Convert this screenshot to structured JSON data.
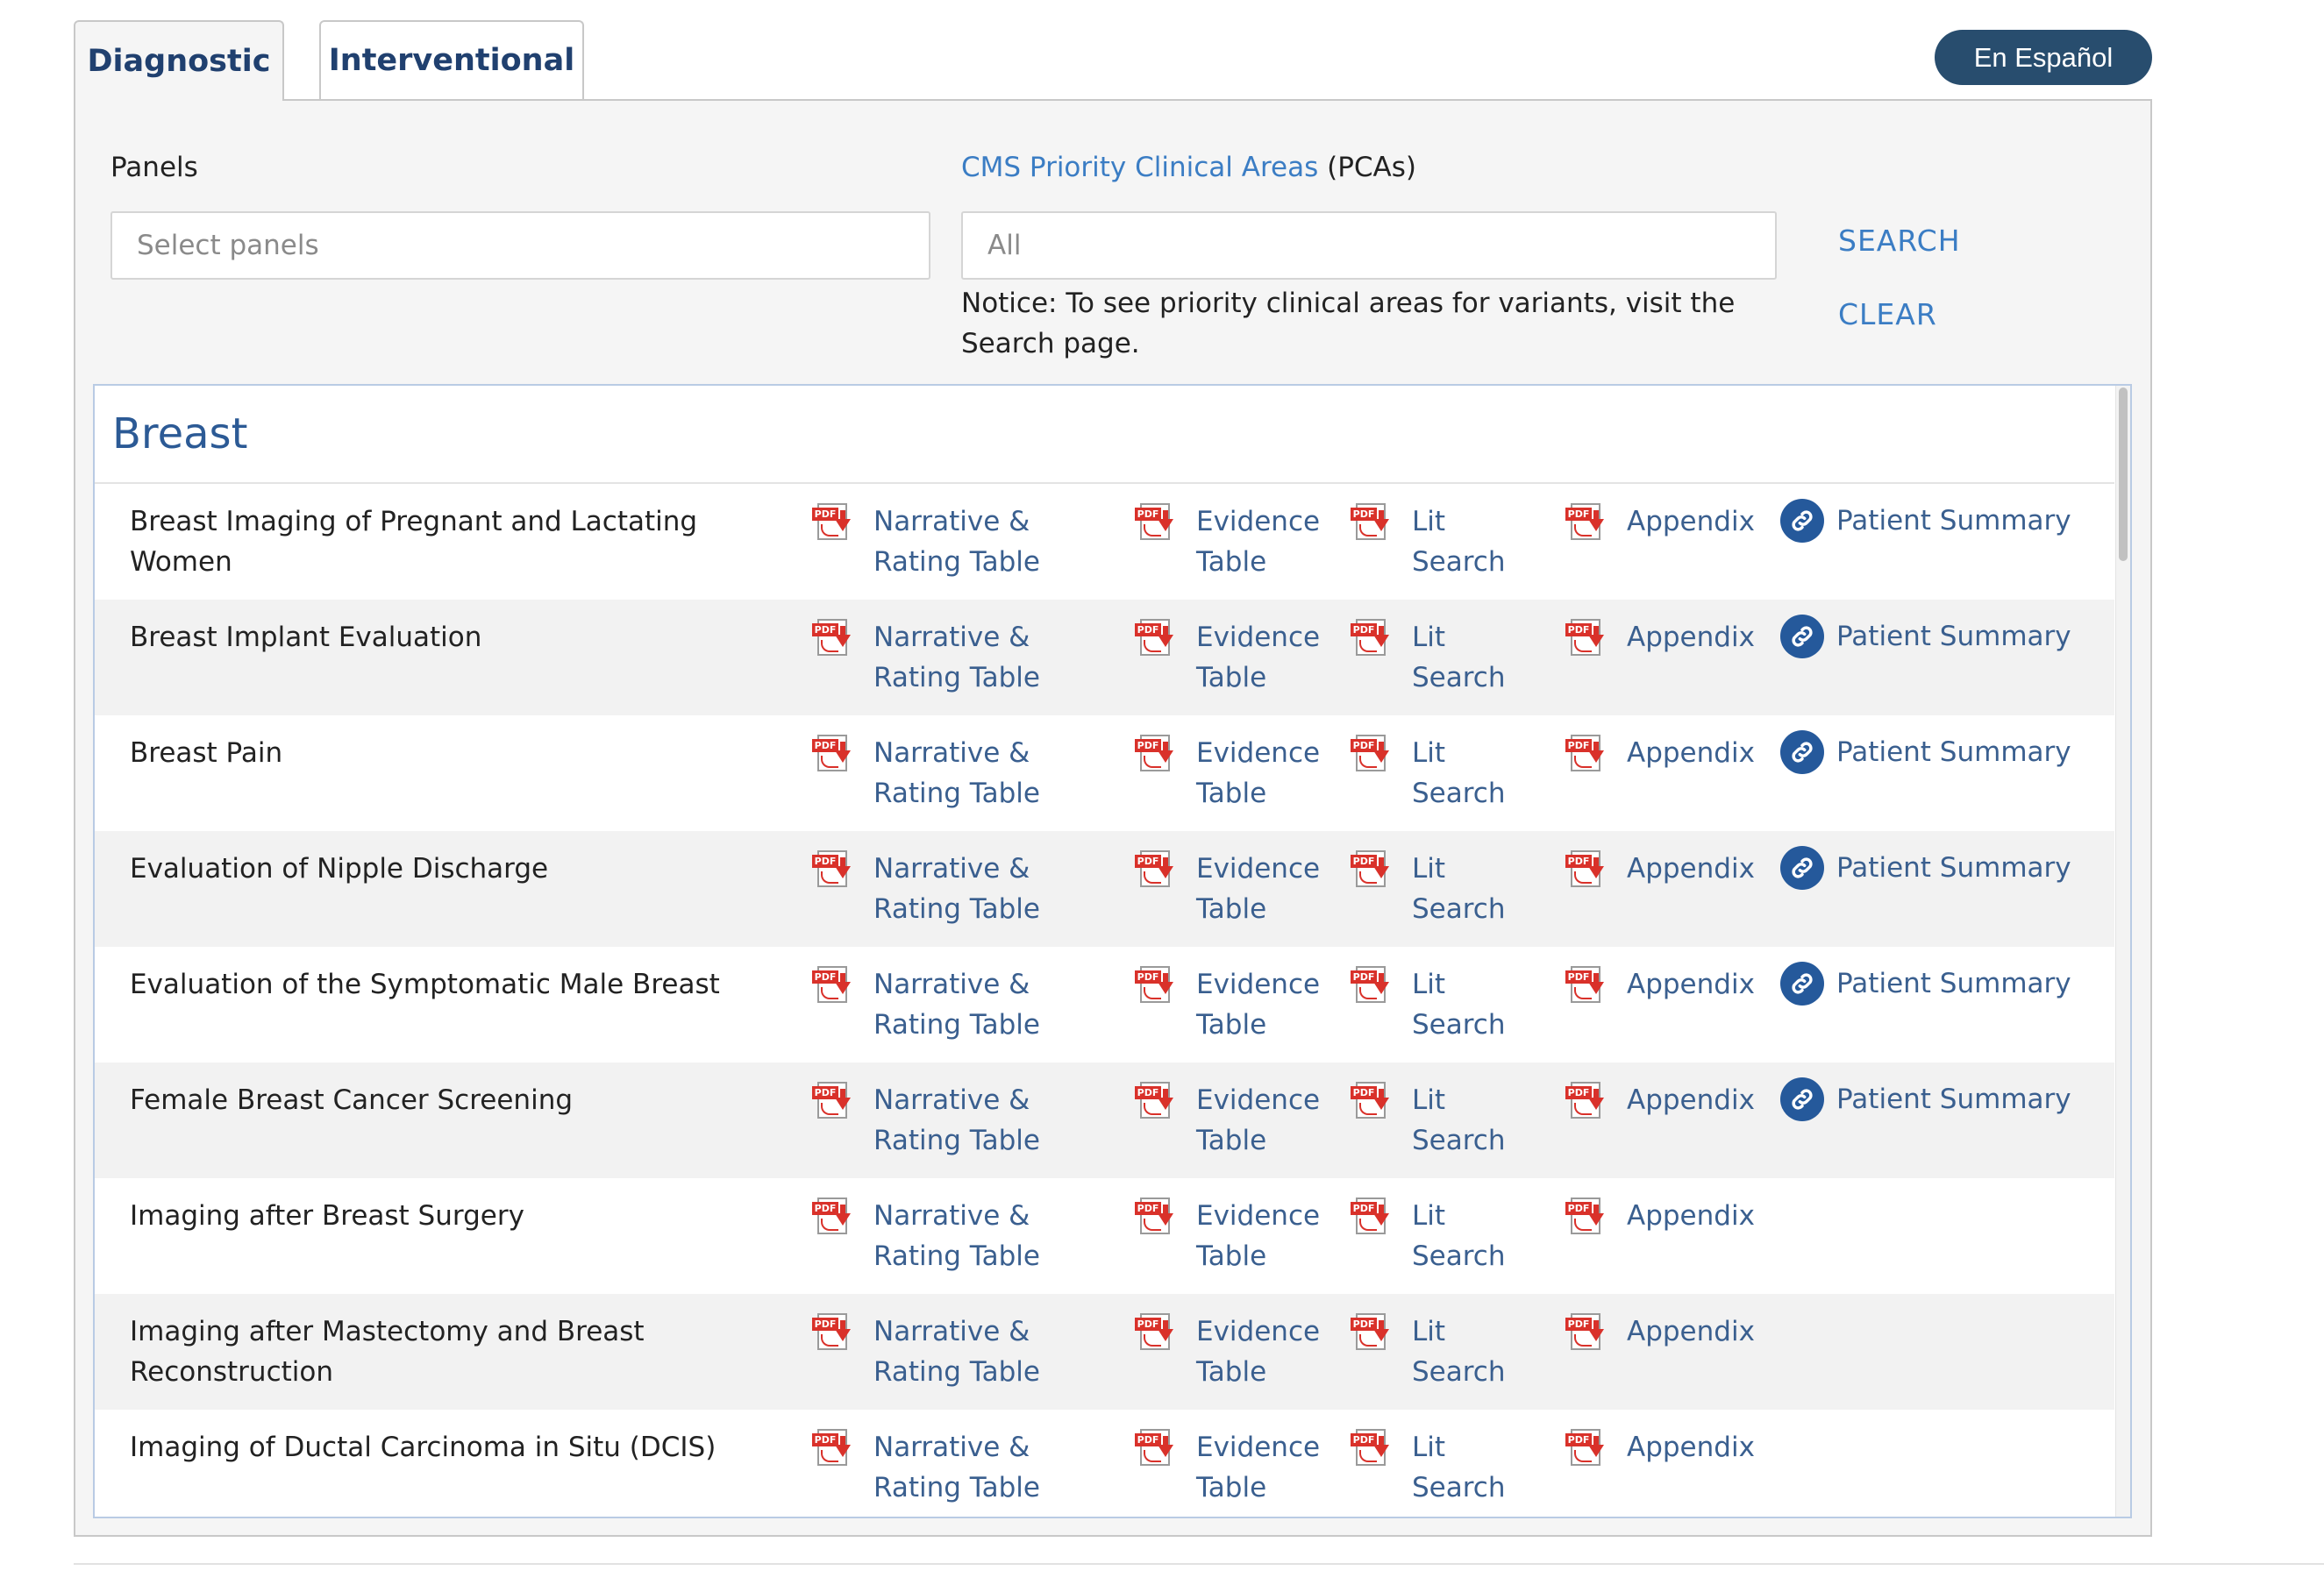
{
  "tabs": [
    {
      "label": "Diagnostic",
      "active": true
    },
    {
      "label": "Interventional",
      "active": false
    }
  ],
  "language_button": "En Español",
  "filters": {
    "panels_label": "Panels",
    "panels_placeholder": "Select panels",
    "pca_link": "CMS Priority Clinical Areas",
    "pca_suffix": " (PCAs)",
    "pca_value": "All",
    "notice": "Notice: To see priority clinical areas for variants, visit the Search page.",
    "search_label": "SEARCH",
    "clear_label": "CLEAR"
  },
  "section": {
    "title": "Breast",
    "rows": [
      {
        "title": "Breast Imaging of Pregnant and Lactating Women",
        "narrative": "Narrative & Rating Table",
        "evidence": "Evidence Table",
        "lit": "Lit Search",
        "appendix": "Appendix",
        "patient": "Patient Summary"
      },
      {
        "title": "Breast Implant Evaluation",
        "narrative": "Narrative & Rating Table",
        "evidence": "Evidence Table",
        "lit": "Lit Search",
        "appendix": "Appendix",
        "patient": "Patient Summary"
      },
      {
        "title": "Breast Pain",
        "narrative": "Narrative & Rating Table",
        "evidence": "Evidence Table",
        "lit": "Lit Search",
        "appendix": "Appendix",
        "patient": "Patient Summary"
      },
      {
        "title": "Evaluation of Nipple Discharge",
        "narrative": "Narrative & Rating Table",
        "evidence": "Evidence Table",
        "lit": "Lit Search",
        "appendix": "Appendix",
        "patient": "Patient Summary"
      },
      {
        "title": "Evaluation of the Symptomatic Male Breast",
        "narrative": "Narrative & Rating Table",
        "evidence": "Evidence Table",
        "lit": "Lit Search",
        "appendix": "Appendix",
        "patient": "Patient Summary"
      },
      {
        "title": "Female Breast Cancer Screening",
        "narrative": "Narrative & Rating Table",
        "evidence": "Evidence Table",
        "lit": "Lit Search",
        "appendix": "Appendix",
        "patient": "Patient Summary"
      },
      {
        "title": "Imaging after Breast Surgery",
        "narrative": "Narrative & Rating Table",
        "evidence": "Evidence Table",
        "lit": "Lit Search",
        "appendix": "Appendix"
      },
      {
        "title": "Imaging after Mastectomy and Breast Reconstruction",
        "narrative": "Narrative & Rating Table",
        "evidence": "Evidence Table",
        "lit": "Lit Search",
        "appendix": "Appendix"
      },
      {
        "title": "Imaging of Ductal Carcinoma in Situ (DCIS)",
        "narrative": "Narrative & Rating Table",
        "evidence": "Evidence Table",
        "lit": "Lit Search",
        "appendix": "Appendix"
      }
    ]
  },
  "colors": {
    "tab_text": "#20406f",
    "language_button_bg": "#284d6e",
    "link_blue": "#3b7dc4",
    "doc_link": "#3a5f8f",
    "section_title": "#2c5a95",
    "pdf_red": "#d9312a",
    "row_alt_bg": "#f2f2f2"
  },
  "icons": {
    "pdf": "pdf-file-icon",
    "patient": "chain-link-icon"
  }
}
